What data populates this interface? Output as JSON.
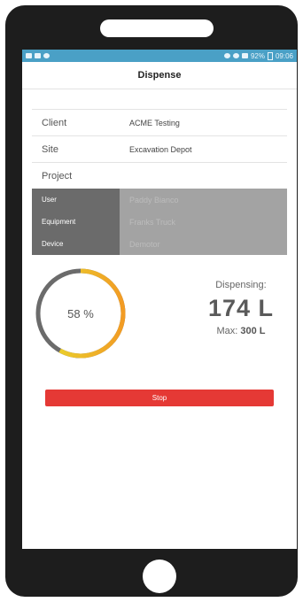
{
  "status_bar": {
    "time": "09:06",
    "battery": "92%"
  },
  "header": {
    "title": "Dispense"
  },
  "info": {
    "client_label": "Client",
    "client_value": "ACME Testing",
    "site_label": "Site",
    "site_value": "Excavation Depot",
    "project_label": "Project",
    "project_value": ""
  },
  "selection": {
    "user_label": "User",
    "user_value": "Paddy Bianco",
    "equipment_label": "Equipment",
    "equipment_value": "Franks Truck",
    "device_label": "Device",
    "device_value": "Demotor"
  },
  "dispense": {
    "percent": 58,
    "percent_text": "58 %",
    "label": "Dispensing:",
    "value": "174 L",
    "max_label": "Max:",
    "max_value": "300 L"
  },
  "actions": {
    "stop_label": "Stop"
  },
  "colors": {
    "status_bar": "#4aa0c6",
    "stop_button": "#e53935",
    "gauge_track": "#6b6b6b",
    "gauge_fill_start": "#e8dd2e",
    "gauge_fill_end": "#f29b24"
  }
}
